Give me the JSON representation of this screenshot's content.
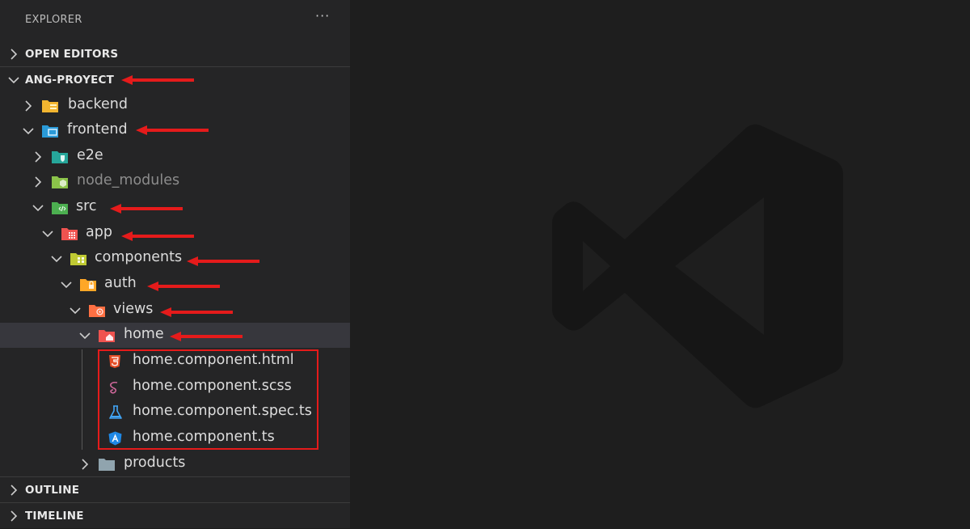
{
  "explorer": {
    "title": "EXPLORER",
    "more_icon": "ellipsis-icon",
    "sections": {
      "open_editors": "OPEN EDITORS",
      "project": "ANG-PROYECT",
      "outline": "OUTLINE",
      "timeline": "TIMELINE"
    }
  },
  "tree": {
    "backend": "backend",
    "frontend": "frontend",
    "e2e": "e2e",
    "node_modules": "node_modules",
    "src": "src",
    "app": "app",
    "components": "components",
    "auth": "auth",
    "views": "views",
    "home": "home",
    "file_html": "home.component.html",
    "file_scss": "home.component.scss",
    "file_spec": "home.component.spec.ts",
    "file_ts": "home.component.ts",
    "products": "products"
  },
  "colors": {
    "sidebar_bg": "#252526",
    "editor_bg": "#1e1e1e",
    "selected_row": "#37373d",
    "annotation_red": "#e51b1b"
  },
  "editor": {
    "watermark_icon": "vscode-logo-icon"
  }
}
